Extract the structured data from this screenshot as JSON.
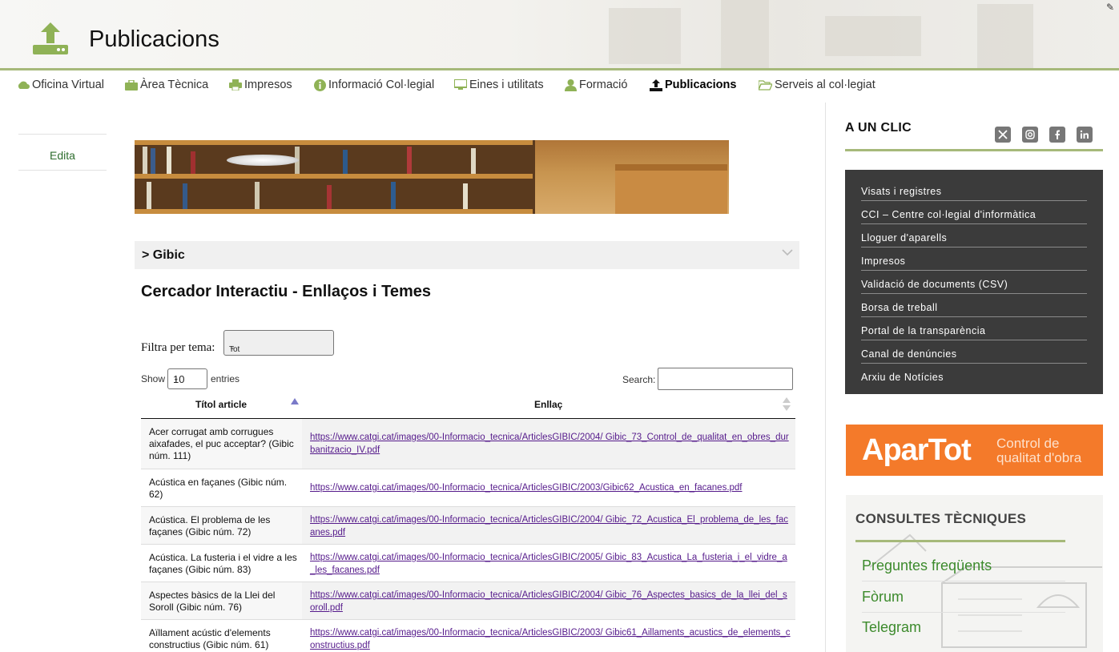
{
  "header": {
    "title": "Publicacions"
  },
  "nav": [
    {
      "label": "Oficina Virtual",
      "icon": "cloud-icon"
    },
    {
      "label": "Àrea Tècnica",
      "icon": "briefcase-icon"
    },
    {
      "label": "Impresos",
      "icon": "printer-icon"
    },
    {
      "label": "Informació Col·legial",
      "icon": "info-icon"
    },
    {
      "label": "Eines i utilitats",
      "icon": "monitor-icon"
    },
    {
      "label": "Formació",
      "icon": "user-icon"
    },
    {
      "label": "Publicacions",
      "icon": "upload-icon",
      "active": true
    },
    {
      "label": "Serveis al col·legiat",
      "icon": "folder-open-icon"
    }
  ],
  "left": {
    "edit_label": "Edita"
  },
  "accordion": {
    "label": "> Gibic"
  },
  "main": {
    "section_title": "Cercador Interactiu - Enllaços i Temes",
    "filter_label": "Filtra per tema:",
    "filter_value": "Tot",
    "show_label": "Show",
    "show_value": "10",
    "entries_label": "entries",
    "search_label": "Search:"
  },
  "table": {
    "headers": [
      "Títol article",
      "Enllaç"
    ],
    "rows": [
      {
        "title": "Acer corrugat amb corrugues aixafades, el puc acceptar? (Gibic núm. 111)",
        "link": "https://www.catgi.cat/images/00-Informacio_tecnica/ArticlesGIBIC/2004/ Gibic_73_Control_de_qualitat_en_obres_durbanitzacio_IV.pdf"
      },
      {
        "title": "Acústica en façanes (Gibic núm. 62)",
        "link": "https://www.catgi.cat/images/00-Informacio_tecnica/ArticlesGIBIC/2003/Gibic62_Acustica_en_facanes.pdf"
      },
      {
        "title": "Acústica. El problema de les façanes (Gibic núm. 72)",
        "link": "https://www.catgi.cat/images/00-Informacio_tecnica/ArticlesGIBIC/2004/ Gibic_72_Acustica_El_problema_de_les_facanes.pdf"
      },
      {
        "title": "Acústica. La fusteria i el vidre a les façanes (Gibic núm. 83)",
        "link": "https://www.catgi.cat/images/00-Informacio_tecnica/ArticlesGIBIC/2005/ Gibic_83_Acustica_La_fusteria_i_el_vidre_a_les_facanes.pdf"
      },
      {
        "title": "Aspectes bàsics de la Llei del Soroll (Gibic núm. 76)",
        "link": "https://www.catgi.cat/images/00-Informacio_tecnica/ArticlesGIBIC/2004/ Gibic_76_Aspectes_basics_de_la_llei_del_soroll.pdf"
      },
      {
        "title": "Aïllament acústic d'elements constructius (Gibic núm. 61)",
        "link": "https://www.catgi.cat/images/00-Informacio_tecnica/ArticlesGIBIC/2003/ Gibic61_Aillaments_acustics_de_elements_constructius.pdf"
      }
    ]
  },
  "right": {
    "aunclic_title": "A UN CLIC",
    "social": [
      "x-icon",
      "instagram-icon",
      "facebook-icon",
      "linkedin-icon"
    ],
    "quick_links": [
      "Visats i registres",
      "CCI – Centre col·legial d'informàtica",
      "Lloguer d'aparells",
      "Impresos",
      "Validació de documents (CSV)",
      "Borsa de treball",
      "Portal de la transparència",
      "Canal de denúncies",
      "Arxiu de Notícies"
    ],
    "apartot": {
      "brand_a": "Apar",
      "brand_b": "Tot",
      "tagline_1": "Control de",
      "tagline_2": "qualitat d'obra"
    },
    "consultes_title": "CONSULTES TÈCNIQUES",
    "consultes_links": [
      "Preguntes freqüents",
      "Fòrum",
      "Telegram"
    ]
  },
  "colors": {
    "accent_green": "#a6b97a",
    "link_green": "#3c8a2c",
    "apartot_orange": "#f47a2a",
    "quick_box_bg": "#3b3b3b"
  }
}
